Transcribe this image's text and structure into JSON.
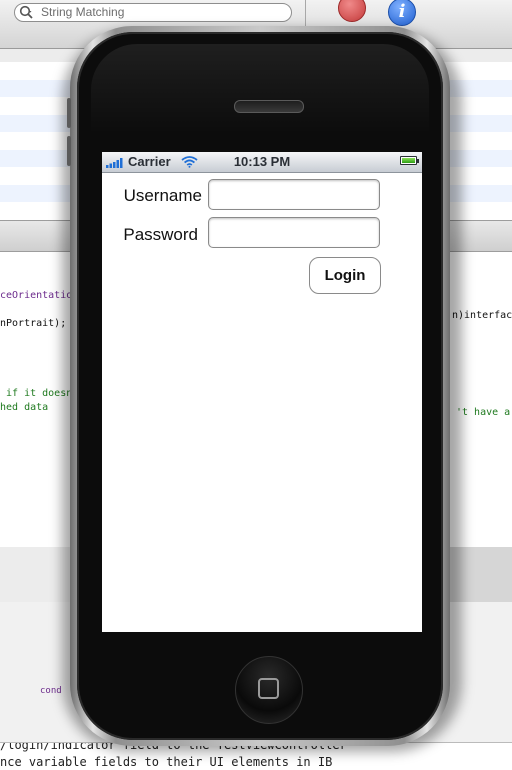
{
  "background": {
    "search": {
      "placeholder": "String Matching"
    },
    "code_lines": [
      {
        "text": "ceOrientatio",
        "color": "purple"
      },
      {
        "text": "nPortrait);",
        "color": "black"
      },
      {
        "text": "n)interfac",
        "color": "black"
      },
      {
        "text": " if it doesn",
        "color": "green"
      },
      {
        "text": "hed data",
        "color": "green"
      },
      {
        "text": "'t have a",
        "color": "green"
      },
      {
        "text": "cond",
        "color": "purple"
      }
    ],
    "bottom_lines": [
      "/logih/indicator field to the TestViewController",
      "nce variable fields to their UI elements in IB"
    ]
  },
  "status_bar": {
    "carrier": "Carrier",
    "time": "10:13 PM"
  },
  "login_form": {
    "username_label": "Username",
    "password_label": "Password",
    "username_value": "",
    "password_value": "",
    "login_label": "Login"
  },
  "colors": {
    "status_bar_text": "#2a2f36",
    "battery": "#2d9e14"
  }
}
